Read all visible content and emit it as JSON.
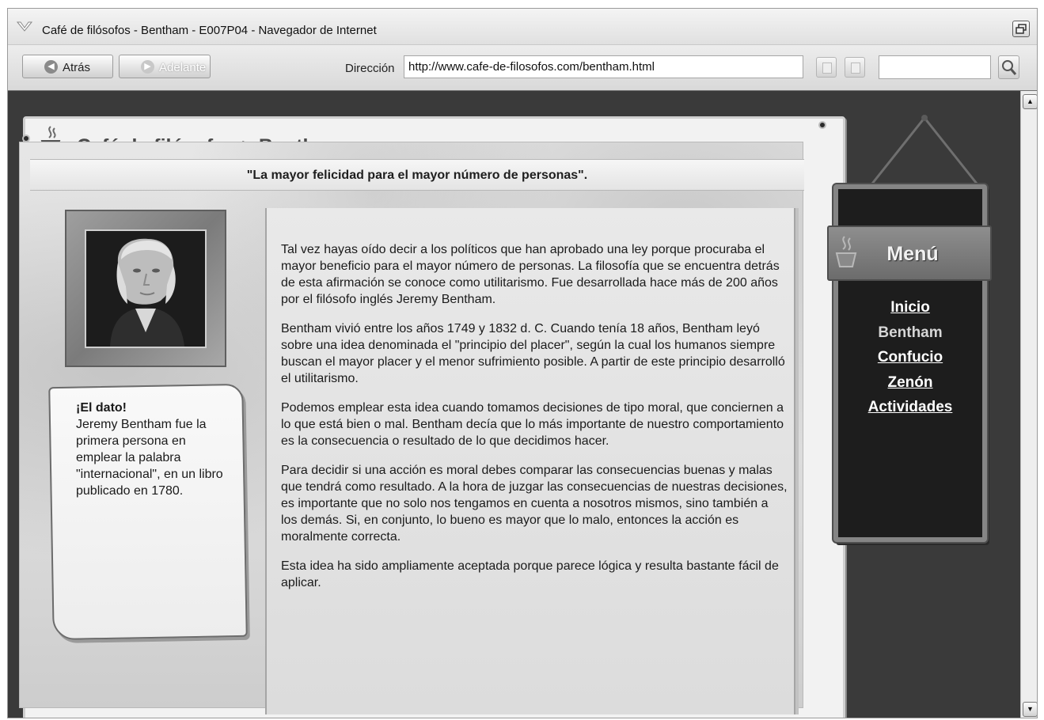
{
  "window": {
    "title": "Café de filósofos - Bentham - E007P04 - Navegador de Internet"
  },
  "toolbar": {
    "back_label": "Atrás",
    "forward_label": "Adelante",
    "address_label": "Dirección",
    "address_value": "http://www.cafe-de-filosofos.com/bentham.html",
    "search_value": ""
  },
  "page": {
    "title": "Café de filósofos > Bentham",
    "quote": "\"La mayor felicidad para el mayor número de personas\".",
    "fact": {
      "title": "¡El dato!",
      "body": "Jeremy Bentham fue la primera persona en emplear la palabra \"internacional\", en un libro publicado en 1780."
    },
    "paragraphs": [
      "Tal vez hayas oído decir a los políticos que han aprobado una ley porque procuraba el mayor beneficio para el mayor número de personas. La filosofía que se encuentra detrás de esta afirmación se conoce como utilitarismo. Fue desarrollada hace más de 200 años por el filósofo inglés Jeremy Bentham.",
      "Bentham vivió entre los años 1749 y 1832 d. C. Cuando tenía 18 años, Bentham leyó sobre una idea denominada el \"principio del placer\", según la cual los humanos siempre buscan el mayor placer y el menor sufrimiento posible. A partir de este principio desarrolló el utilitarismo.",
      "Podemos emplear esta idea cuando tomamos decisiones de tipo moral, que conciernen a lo que está bien o mal. Bentham decía que lo más importante de nuestro comportamiento es la consecuencia o resultado de lo que decidimos hacer.",
      "Para decidir si una acción es moral debes comparar las consecuencias buenas y malas que tendrá como resultado. A la hora de juzgar las consecuencias de nuestras decisiones, es importante que no solo nos tengamos en cuenta a nosotros mismos, sino también a los demás. Si, en conjunto, lo bueno es mayor que lo malo, entonces la acción es moralmente correcta.",
      "Esta idea ha sido ampliamente aceptada porque parece lógica y resulta bastante fácil de aplicar."
    ]
  },
  "menu": {
    "title": "Menú",
    "items": [
      {
        "label": "Inicio",
        "current": false
      },
      {
        "label": "Bentham",
        "current": true
      },
      {
        "label": "Confucio",
        "current": false
      },
      {
        "label": "Zenón",
        "current": false
      },
      {
        "label": "Actividades",
        "current": false
      }
    ]
  },
  "icons": {
    "app": "browser-app-icon",
    "restore": "window-restore-icon",
    "back": "arrow-left-icon",
    "forward": "arrow-right-icon",
    "search": "magnifier-icon",
    "cup": "coffee-cup-icon",
    "scroll_up": "scroll-up-arrow-icon",
    "scroll_down": "scroll-down-arrow-icon"
  }
}
